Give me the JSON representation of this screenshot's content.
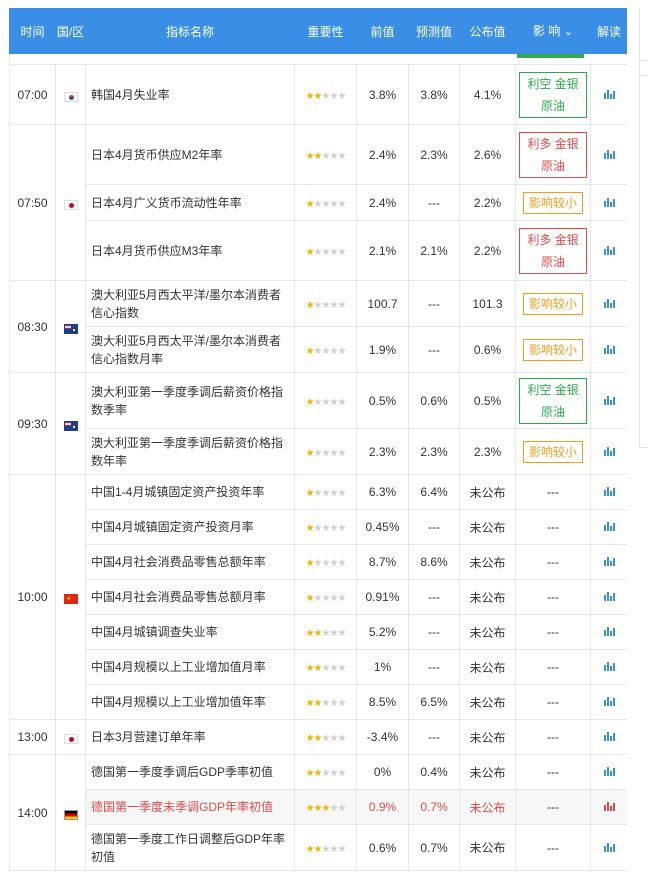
{
  "headers": {
    "time": "时间",
    "region": "国/区",
    "name": "指标名称",
    "importance": "重要性",
    "prev": "前值",
    "forecast": "预测值",
    "actual": "公布值",
    "impact": "影 响",
    "impact_arrow": "⌄",
    "interpret": "解读"
  },
  "colors": {
    "header_bg": "#3a8ee6",
    "bullish_green": "#2fa84f",
    "bearish_red": "#e04a4a",
    "neutral_orange": "#f0a020",
    "star": "#f4b400"
  },
  "groups": [
    {
      "time": "07:00",
      "flag": "kr",
      "rows": [
        {
          "name": "韩国4月失业率",
          "stars": 2,
          "prev": "3.8%",
          "forecast": "3.8%",
          "actual": "4.1%",
          "impact": {
            "type": "green",
            "text": "利空 金银 原油"
          }
        }
      ]
    },
    {
      "time": "07:50",
      "flag": "jp",
      "rows": [
        {
          "name": "日本4月货币供应M2年率",
          "stars": 2,
          "prev": "2.4%",
          "forecast": "2.3%",
          "actual": "2.6%",
          "impact": {
            "type": "red",
            "text": "利多 金银 原油"
          }
        },
        {
          "name": "日本4月广义货币流动性年率",
          "stars": 1,
          "prev": "2.4%",
          "forecast": "---",
          "actual": "2.2%",
          "impact": {
            "type": "orange",
            "text": "影响较小"
          }
        },
        {
          "name": "日本4月货币供应M3年率",
          "stars": 1,
          "prev": "2.1%",
          "forecast": "2.1%",
          "actual": "2.2%",
          "impact": {
            "type": "red",
            "text": "利多 金银 原油"
          }
        }
      ]
    },
    {
      "time": "08:30",
      "flag": "au",
      "rows": [
        {
          "name": "澳大利亚5月西太平洋/墨尔本消费者信心指数",
          "stars": 1,
          "prev": "100.7",
          "forecast": "---",
          "actual": "101.3",
          "impact": {
            "type": "orange",
            "text": "影响较小"
          }
        },
        {
          "name": "澳大利亚5月西太平洋/墨尔本消费者信心指数月率",
          "stars": 1,
          "prev": "1.9%",
          "forecast": "---",
          "actual": "0.6%",
          "impact": {
            "type": "orange",
            "text": "影响较小"
          }
        }
      ]
    },
    {
      "time": "09:30",
      "flag": "au",
      "rows": [
        {
          "name": "澳大利亚第一季度季调后薪资价格指数季率",
          "stars": 1,
          "prev": "0.5%",
          "forecast": "0.6%",
          "actual": "0.5%",
          "impact": {
            "type": "green",
            "text": "利空 金银 原油"
          }
        },
        {
          "name": "澳大利亚第一季度季调后薪资价格指数年率",
          "stars": 1,
          "prev": "2.3%",
          "forecast": "2.3%",
          "actual": "2.3%",
          "impact": {
            "type": "orange",
            "text": "影响较小"
          }
        }
      ]
    },
    {
      "time": "10:00",
      "flag": "cn",
      "rows": [
        {
          "name": "中国1-4月城镇固定资产投资年率",
          "stars": 1,
          "prev": "6.3%",
          "forecast": "6.4%",
          "actual": "未公布",
          "impact": {
            "type": "none",
            "text": "---"
          }
        },
        {
          "name": "中国4月城镇固定资产投资月率",
          "stars": 1,
          "prev": "0.45%",
          "forecast": "---",
          "actual": "未公布",
          "impact": {
            "type": "none",
            "text": "---"
          }
        },
        {
          "name": "中国4月社会消费品零售总额年率",
          "stars": 1,
          "prev": "8.7%",
          "forecast": "8.6%",
          "actual": "未公布",
          "impact": {
            "type": "none",
            "text": "---"
          }
        },
        {
          "name": "中国4月社会消费品零售总额月率",
          "stars": 1,
          "prev": "0.91%",
          "forecast": "---",
          "actual": "未公布",
          "impact": {
            "type": "none",
            "text": "---"
          }
        },
        {
          "name": "中国4月城镇调查失业率",
          "stars": 2,
          "prev": "5.2%",
          "forecast": "---",
          "actual": "未公布",
          "impact": {
            "type": "none",
            "text": "---"
          }
        },
        {
          "name": "中国4月规模以上工业增加值月率",
          "stars": 2,
          "prev": "1%",
          "forecast": "---",
          "actual": "未公布",
          "impact": {
            "type": "none",
            "text": "---"
          }
        },
        {
          "name": "中国4月规模以上工业增加值年率",
          "stars": 2,
          "prev": "8.5%",
          "forecast": "6.5%",
          "actual": "未公布",
          "impact": {
            "type": "none",
            "text": "---"
          }
        }
      ]
    },
    {
      "time": "13:00",
      "flag": "jp",
      "rows": [
        {
          "name": "日本3月营建订单年率",
          "stars": 2,
          "prev": "-3.4%",
          "forecast": "---",
          "actual": "未公布",
          "impact": {
            "type": "none",
            "text": "---"
          }
        }
      ]
    },
    {
      "time": "14:00",
      "flag": "de",
      "rows": [
        {
          "name": "德国第一季度季调后GDP季率初值",
          "stars": 2,
          "prev": "0%",
          "forecast": "0.4%",
          "actual": "未公布",
          "impact": {
            "type": "none",
            "text": "---"
          }
        },
        {
          "name": "德国第一季度未季调GDP年率初值",
          "stars": 3,
          "highlight": true,
          "prev": "0.9%",
          "forecast": "0.7%",
          "actual": "未公布",
          "impact": {
            "type": "none",
            "text": "---"
          }
        },
        {
          "name": "德国第一季度工作日调整后GDP年率初值",
          "stars": 2,
          "prev": "0.6%",
          "forecast": "0.7%",
          "actual": "未公布",
          "impact": {
            "type": "none",
            "text": "---"
          }
        }
      ]
    }
  ]
}
